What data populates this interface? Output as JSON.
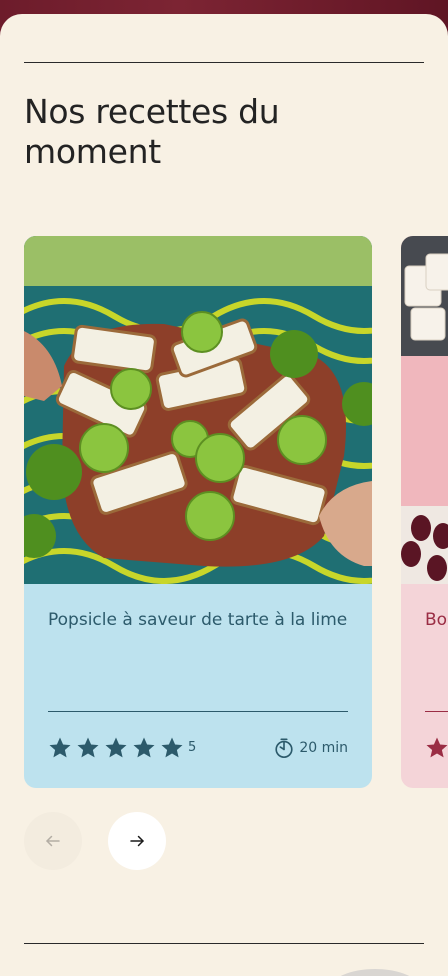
{
  "section": {
    "title": "Nos recettes du moment"
  },
  "cards": [
    {
      "title": "Popsicle à saveur de tarte à la lime",
      "rating": "5",
      "time": "20 min",
      "image_desc_icon": "lime-popsicles-photo"
    },
    {
      "title": "Bo"
    }
  ],
  "nav": {
    "prev_icon": "arrow-left-icon",
    "next_icon": "arrow-right-icon"
  },
  "colors": {
    "page_bg": "#f8f1e4",
    "card_blue": "#bde2ee",
    "card_pink": "#f4d4d8",
    "card_text": "#2c5a6b",
    "accent_red": "#9a2d44"
  }
}
